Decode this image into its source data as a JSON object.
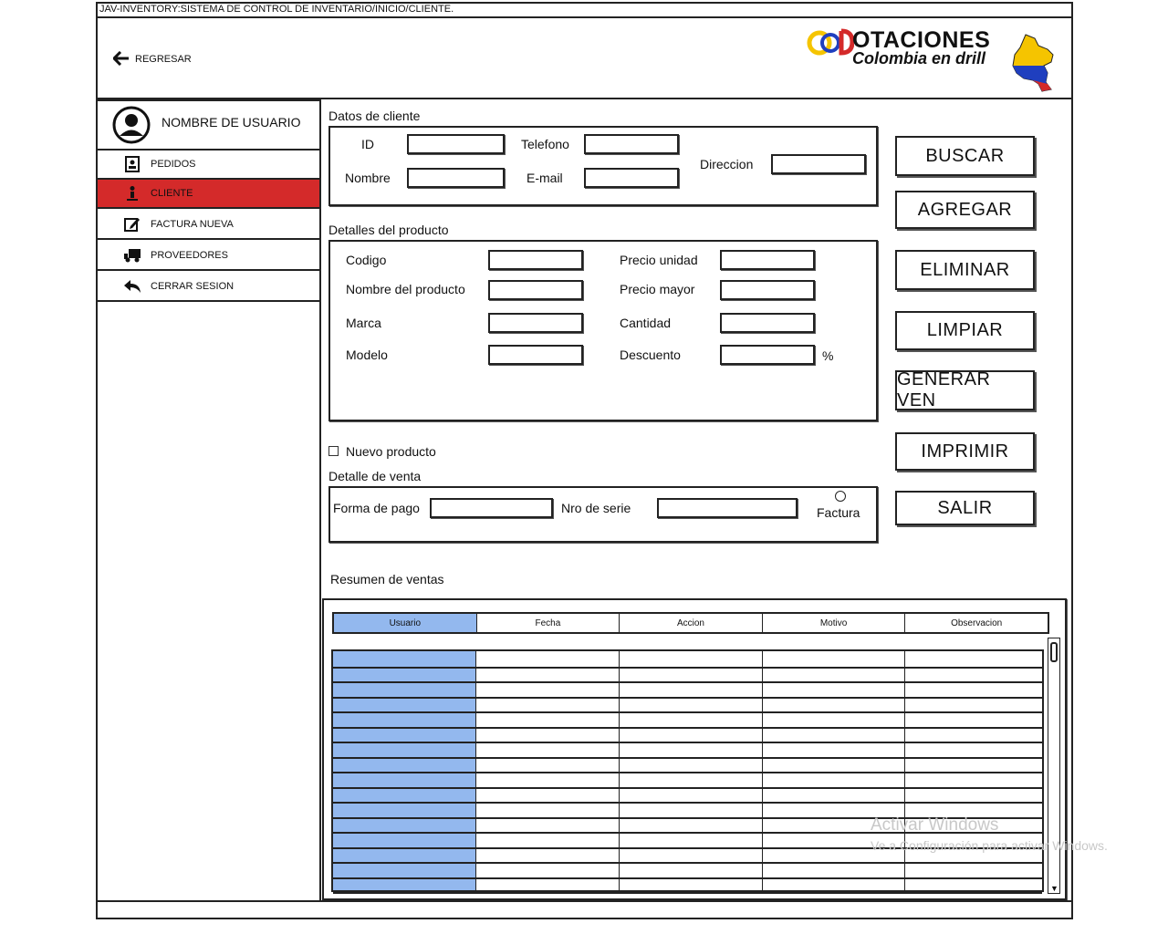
{
  "window": {
    "title": "JAV-INVENTORY:SISTEMA DE CONTROL DE INVENTARIO/INICIO/CLIENTE."
  },
  "header": {
    "back_label": "REGRESAR",
    "logo": {
      "mark": "CD",
      "word": "OTACIONES",
      "tagline": "Colombia en drill"
    }
  },
  "sidebar": {
    "user_name": "NOMBRE DE USUARIO",
    "items": [
      {
        "label": "PEDIDOS",
        "icon": "contact-book-icon"
      },
      {
        "label": "CLIENTE",
        "icon": "person-icon",
        "active": true
      },
      {
        "label": "FACTURA NUEVA",
        "icon": "edit-icon"
      },
      {
        "label": "PROVEEDORES",
        "icon": "truck-icon"
      },
      {
        "label": "CERRAR SESION",
        "icon": "reply-icon"
      }
    ]
  },
  "cliente": {
    "section_label": "Datos de cliente",
    "id_label": "ID",
    "telefono_label": "Telefono",
    "direccion_label": "Direccion",
    "nombre_label": "Nombre",
    "email_label": "E-mail"
  },
  "producto": {
    "section_label": "Detalles del producto",
    "codigo_label": "Codigo",
    "nombre_label": "Nombre del producto",
    "marca_label": "Marca",
    "modelo_label": "Modelo",
    "precio_unidad_label": "Precio unidad",
    "precio_mayor_label": "Precio mayor",
    "cantidad_label": "Cantidad",
    "descuento_label": "Descuento",
    "percent": "%"
  },
  "nuevo_producto_label": "Nuevo producto",
  "venta": {
    "section_label": "Detalle de venta",
    "forma_pago_label": "Forma de pago",
    "nro_serie_label": "Nro de serie",
    "factura_label": "Factura"
  },
  "buttons": {
    "buscar": "BUSCAR",
    "agregar": "AGREGAR",
    "eliminar": "ELIMINAR",
    "limpiar": "LIMPIAR",
    "generar": "GENERAR VEN",
    "imprimir": "IMPRIMIR",
    "salir": "SALIR"
  },
  "resumen": {
    "section_label": "Resumen de ventas",
    "columns": [
      "Usuario",
      "Fecha",
      "Accion",
      "Motivo",
      "Observacion"
    ]
  },
  "watermark": {
    "line1": "Activar Windows",
    "line2": "Ve a Configuración para activar Windows."
  },
  "colors": {
    "active_nav": "#d42a2a",
    "selected_column": "#93b8ee"
  }
}
